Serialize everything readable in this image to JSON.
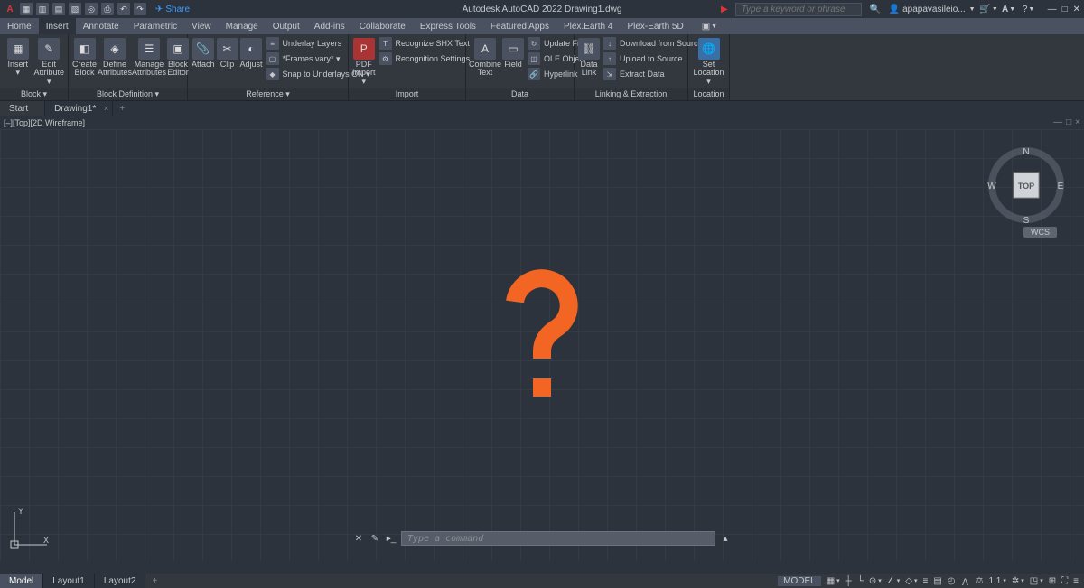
{
  "app": {
    "title": "Autodesk AutoCAD 2022   Drawing1.dwg",
    "logo_letter": "A"
  },
  "qat": {
    "share_label": "Share"
  },
  "search": {
    "placeholder": "Type a keyword or phrase",
    "user": "apapavasileio..."
  },
  "tabs": [
    "Home",
    "Insert",
    "Annotate",
    "Parametric",
    "View",
    "Manage",
    "Output",
    "Add-ins",
    "Collaborate",
    "Express Tools",
    "Featured Apps",
    "Plex.Earth 4",
    "Plex-Earth 5D"
  ],
  "active_tab": "Insert",
  "ribbon": {
    "block": {
      "title": "Block ▾",
      "insert": "Insert\n▾",
      "edit_attr": "Edit\nAttribute ▾"
    },
    "blockdef": {
      "title": "Block Definition ▾",
      "create": "Create\nBlock",
      "define": "Define\nAttributes",
      "manage": "Manage\nAttributes",
      "editor": "Block\nEditor"
    },
    "reference": {
      "title": "Reference ▾",
      "attach": "Attach",
      "clip": "Clip",
      "adjust": "Adjust",
      "underlay": "Underlay Layers",
      "frames": "*Frames vary* ▾",
      "snap": "Snap to Underlays ON ▾"
    },
    "import": {
      "title": "Import",
      "pdf": "PDF\nImport ▾",
      "shx": "Recognize SHX Text",
      "settings": "Recognition Settings"
    },
    "data": {
      "title": "Data",
      "combine": "Combine\nText",
      "field": "Field",
      "update": "Update Fields",
      "ole": "OLE Object",
      "hyper": "Hyperlink",
      "link": "Data\nLink",
      "dl": "Download from Source",
      "up": "Upload to Source",
      "ext": "Extract  Data"
    },
    "linkext": {
      "title": "Linking & Extraction"
    },
    "location": {
      "title": "Location",
      "set": "Set\nLocation ▾"
    }
  },
  "filetabs": {
    "start": "Start",
    "drawing": "Drawing1*"
  },
  "vplabel": "[–][Top][2D Wireframe]",
  "viewcube": {
    "top": "TOP",
    "n": "N",
    "s": "S",
    "e": "E",
    "w": "W"
  },
  "wcs": "WCS",
  "ucs": {
    "y": "Y",
    "x": "X"
  },
  "cmdline": {
    "placeholder": "Type a command"
  },
  "bottom_tabs": [
    "Model",
    "Layout1",
    "Layout2"
  ],
  "status": {
    "model": "MODEL",
    "scale": "1:1"
  }
}
